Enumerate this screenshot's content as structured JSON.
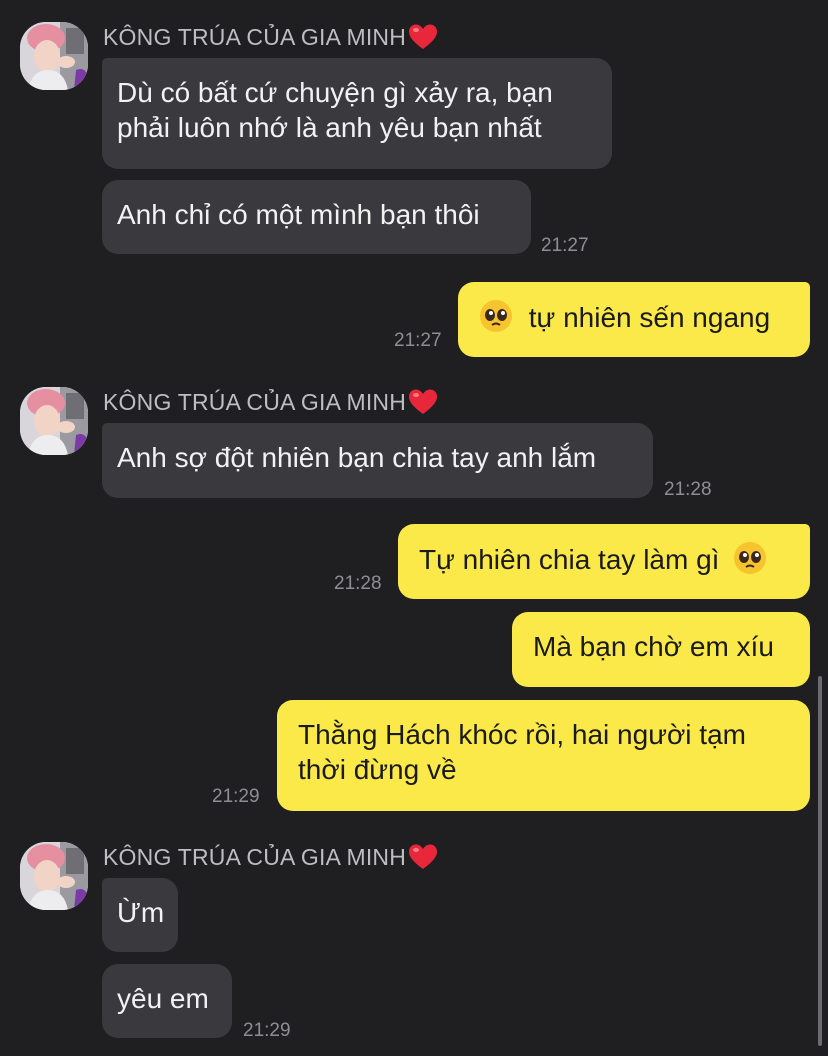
{
  "sender": {
    "name": "KÔNG TRÚA CỦA GIA MINH",
    "avatar": "avatar-photo"
  },
  "messages": [
    {
      "from": "them",
      "lines": [
        "Dù có bất cứ chuyện gì xảy ra, bạn",
        "phải luôn nhớ là anh yêu bạn nhất"
      ]
    },
    {
      "from": "them",
      "lines": [
        "Anh chỉ có một mình bạn thôi"
      ],
      "time": "21:27"
    },
    {
      "from": "me",
      "emoji": "pleading-face-icon",
      "text": "tự nhiên sến ngang",
      "time": "21:27"
    },
    {
      "from": "them",
      "lines": [
        "Anh sợ đột nhiên bạn chia tay anh lắm"
      ],
      "time": "21:28"
    },
    {
      "from": "me",
      "text": "Tự nhiên chia tay làm gì",
      "emoji": "pleading-face-icon",
      "time": "21:28"
    },
    {
      "from": "me",
      "text": "Mà bạn chờ em xíu"
    },
    {
      "from": "me",
      "lines": [
        "Thằng Hách khóc rồi, hai người tạm",
        "thời đừng về"
      ],
      "time": "21:29"
    },
    {
      "from": "them",
      "lines": [
        "Ừm"
      ]
    },
    {
      "from": "them",
      "lines": [
        "yêu em"
      ],
      "time": "21:29"
    }
  ],
  "colors": {
    "background": "#1f1f21",
    "incoming_bubble": "#3a3a3e",
    "outgoing_bubble": "#fbe94a",
    "name_text": "#bdbdc2",
    "time_text": "#8e8e93"
  }
}
